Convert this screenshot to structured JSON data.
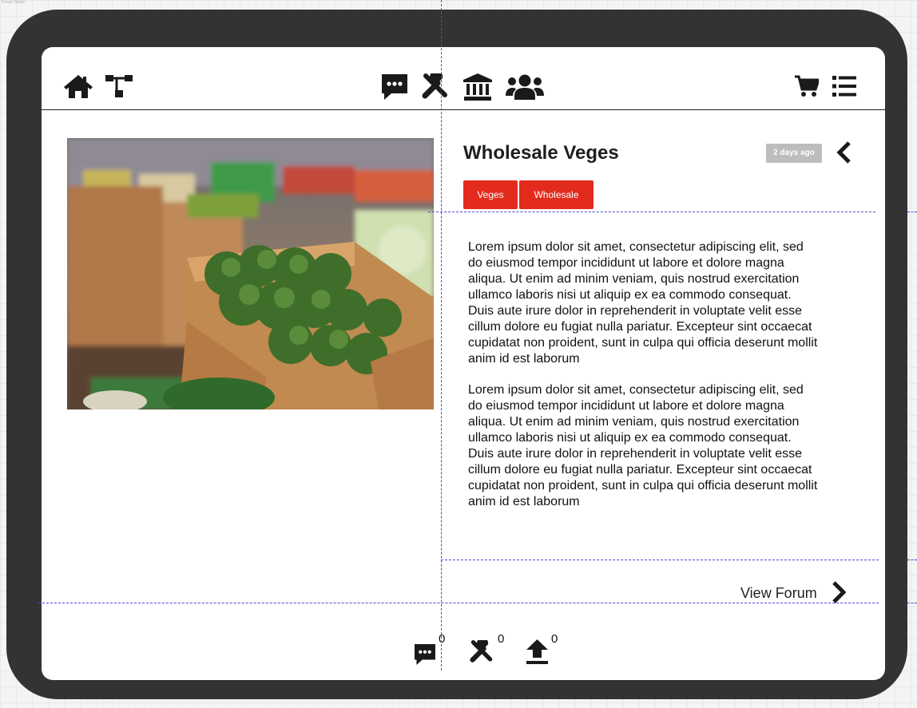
{
  "window_label": "Forum Detail",
  "nav": {
    "left_icons": [
      "home-icon",
      "sitemap-icon"
    ],
    "center_icons": [
      "chat-icon",
      "tools-icon",
      "bank-icon",
      "users-icon"
    ],
    "right_icons": [
      "cart-icon",
      "list-icon"
    ]
  },
  "post": {
    "title": "Wholesale Veges",
    "time_ago": "2 days ago",
    "tags": [
      "Veges",
      "Wholesale"
    ],
    "paragraphs": [
      "Lorem ipsum dolor sit amet, consectetur adipiscing elit, sed do eiusmod tempor incididunt ut labore et dolore magna aliqua. Ut enim ad minim veniam, quis nostrud exercitation ullamco laboris nisi ut aliquip ex ea commodo consequat. Duis aute irure dolor in reprehenderit in voluptate velit esse cillum dolore eu fugiat nulla pariatur. Excepteur sint occaecat cupidatat non proident, sunt in culpa qui officia deserunt mollit anim id est laborum",
      "Lorem ipsum dolor sit amet, consectetur adipiscing elit, sed do eiusmod tempor incididunt ut labore et dolore magna aliqua. Ut enim ad minim veniam, quis nostrud exercitation ullamco laboris nisi ut aliquip ex ea commodo consequat. Duis aute irure dolor in reprehenderit in voluptate velit esse cillum dolore eu fugiat nulla pariatur. Excepteur sint occaecat cupidatat non proident, sunt in culpa qui officia deserunt mollit anim id est laborum"
    ],
    "image": "vegetable-market-photo"
  },
  "view_forum_label": "View Forum",
  "footer": {
    "comments_count": "0",
    "tools_count": "0",
    "uploads_count": "0"
  },
  "colors": {
    "tag_bg": "#e32b1d",
    "badge_bg": "#bdbdbd",
    "frame": "#333333",
    "guide": "#4a4ad8"
  }
}
